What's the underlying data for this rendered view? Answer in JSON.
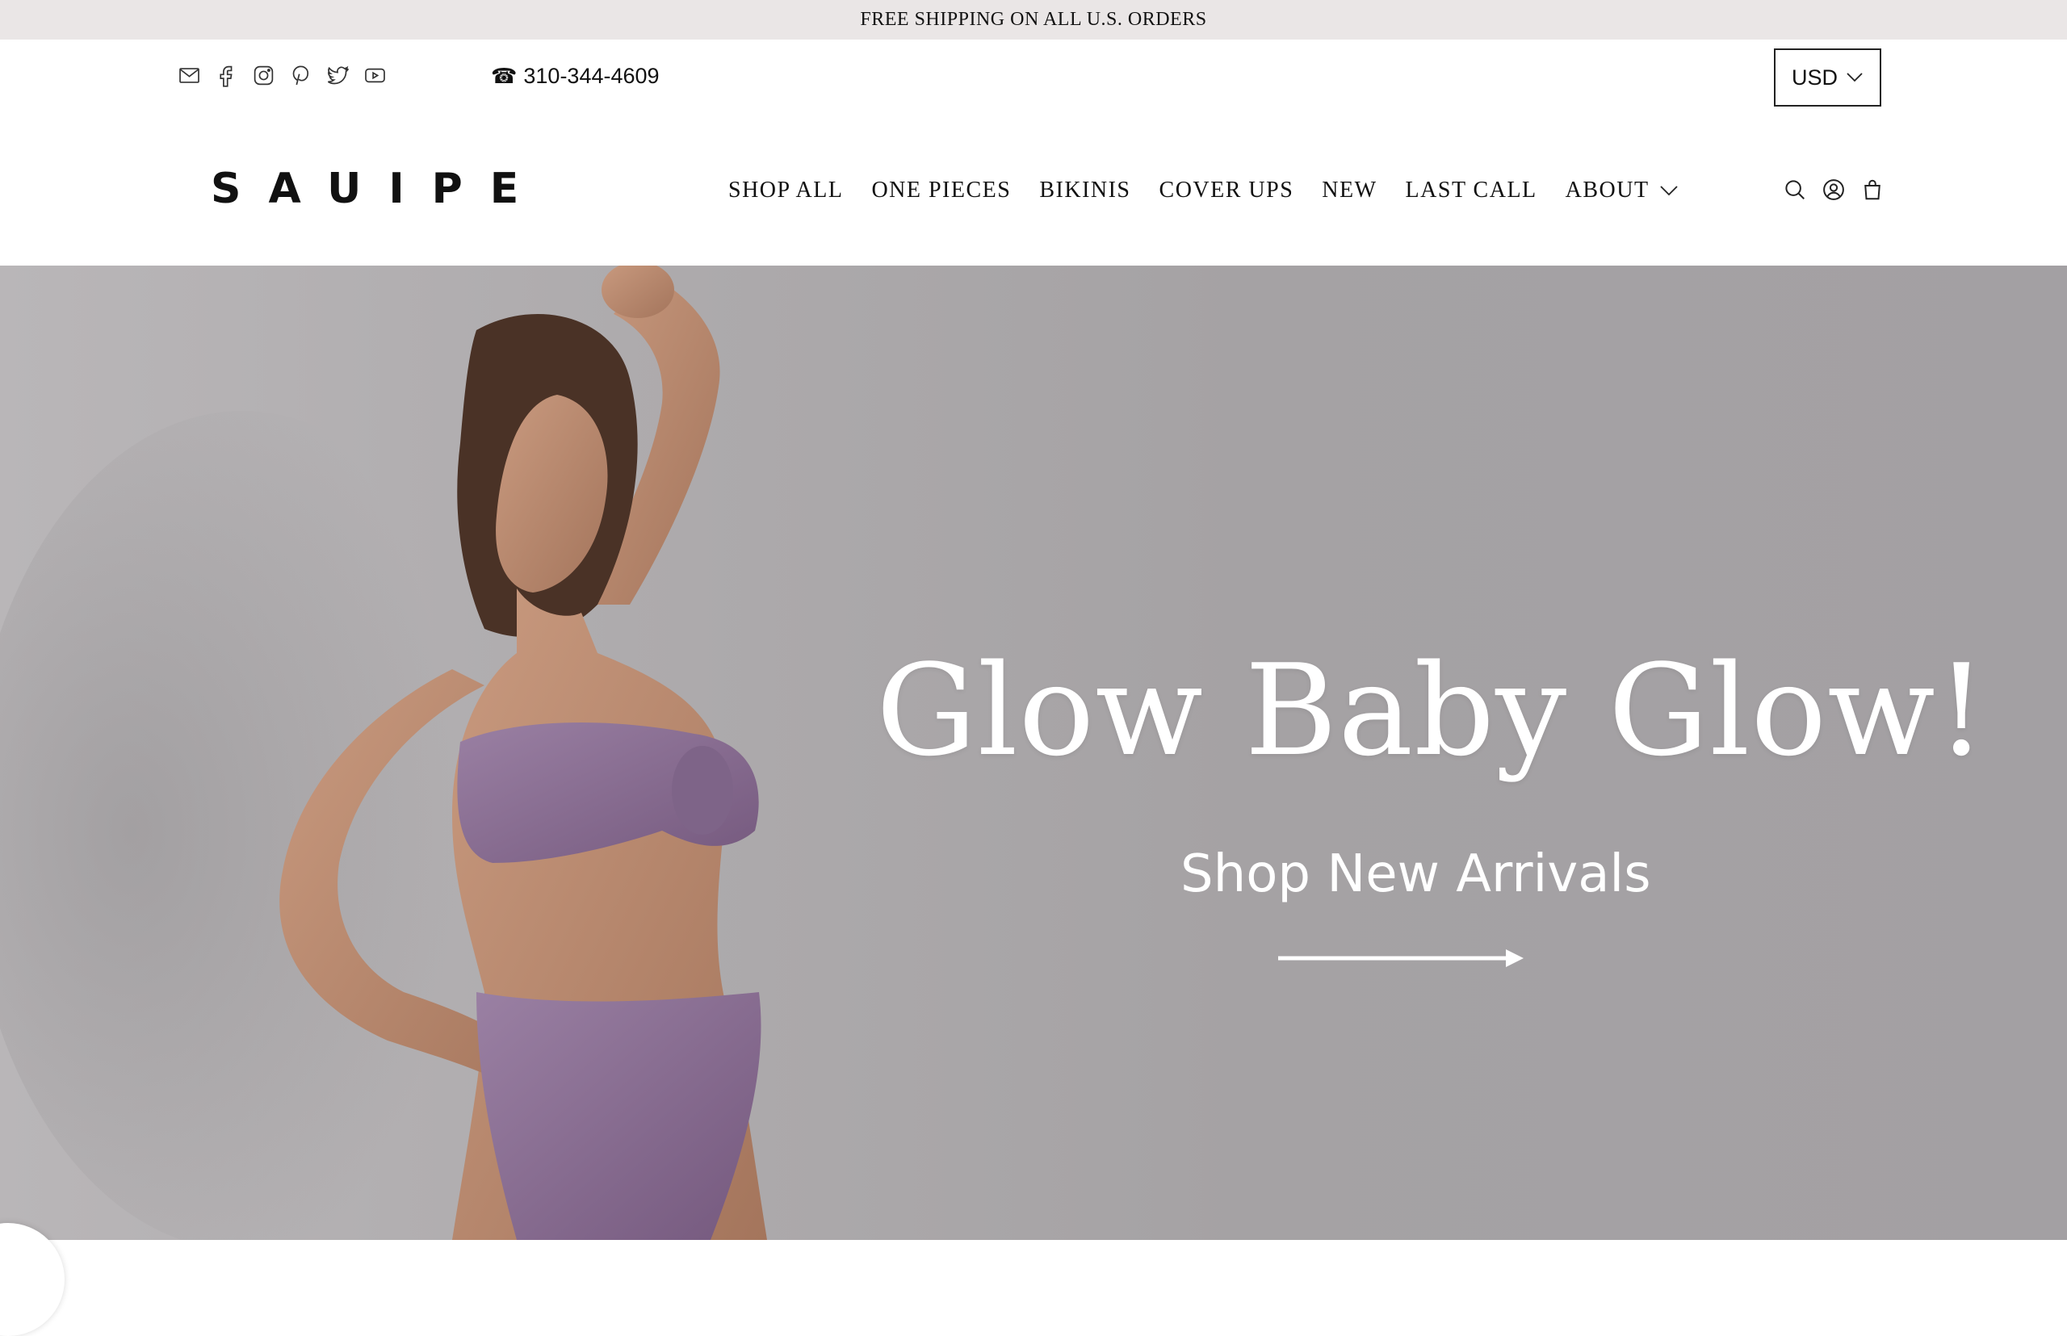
{
  "announcement": {
    "text": "FREE SHIPPING ON ALL U.S. ORDERS"
  },
  "utility": {
    "social_icons": [
      "mail-icon",
      "facebook-icon",
      "instagram-icon",
      "pinterest-icon",
      "twitter-icon",
      "youtube-icon"
    ],
    "phone_icon": "☎",
    "phone": "310-344-4609",
    "currency": "USD"
  },
  "header": {
    "logo": "SAUIPE",
    "nav": [
      {
        "label": "SHOP ALL"
      },
      {
        "label": "ONE PIECES"
      },
      {
        "label": "BIKINIS"
      },
      {
        "label": "COVER UPS"
      },
      {
        "label": "NEW"
      },
      {
        "label": "LAST CALL"
      },
      {
        "label": "ABOUT"
      }
    ],
    "right_icons": [
      "search-icon",
      "account-icon",
      "cart-icon"
    ]
  },
  "hero": {
    "title": "Glow Baby Glow!",
    "cta": "Shop New Arrivals",
    "background_color": "#a8a5a7",
    "swimsuit_color": "#8a6f92"
  }
}
